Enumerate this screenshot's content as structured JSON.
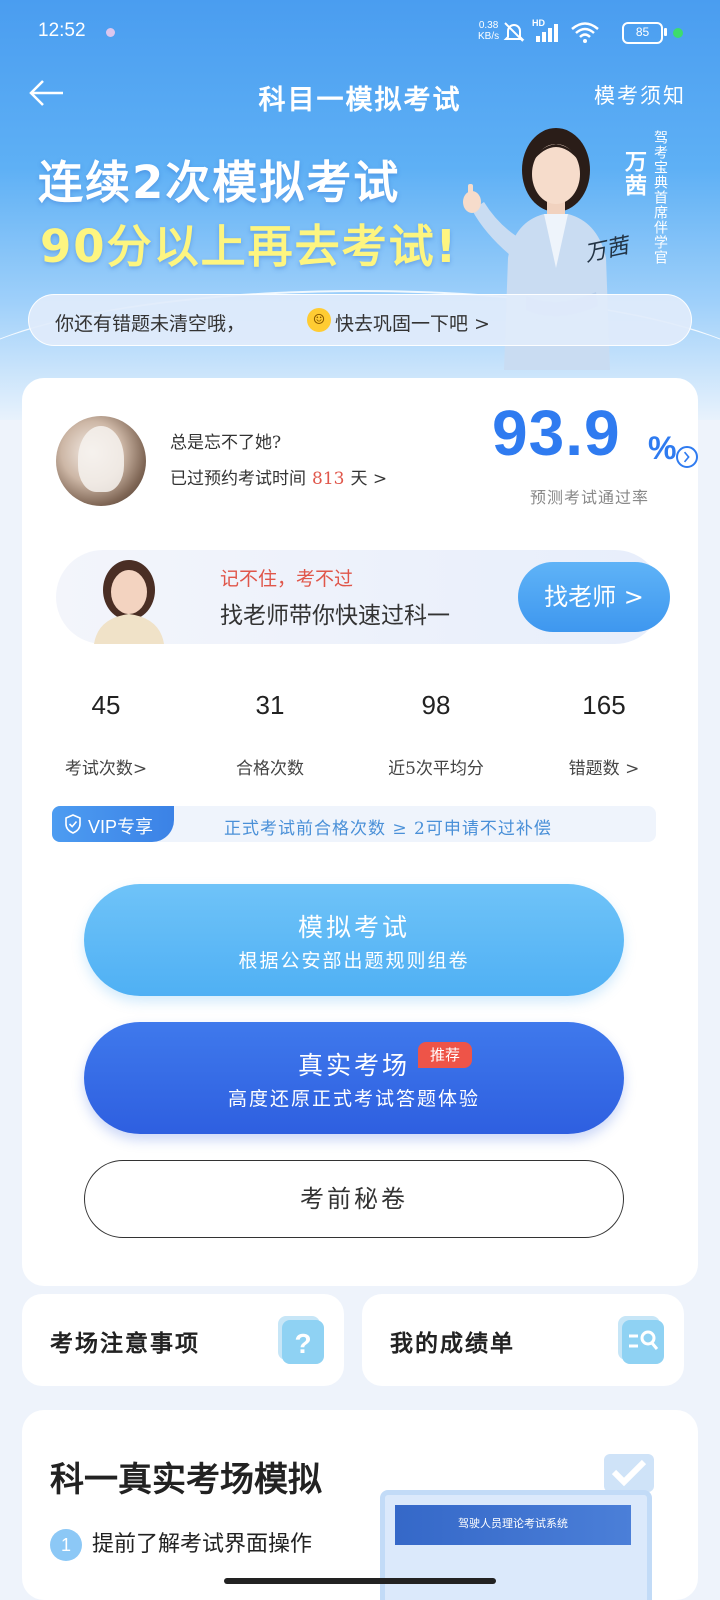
{
  "status_bar": {
    "time": "12:52",
    "net_speed_value": "0.38",
    "net_speed_unit": "KB/s",
    "network_label": "HD",
    "battery": "85"
  },
  "nav": {
    "title": "科目一模拟考试",
    "notice_link": "模考须知"
  },
  "banner": {
    "line1": "连续2次模拟考试",
    "line2": "90分以上再去考试!",
    "name": "万茜",
    "role": "驾考宝典首席伴学官",
    "signature": "万茜"
  },
  "tip": {
    "text_before": "你还有错题未清空哦，",
    "emoji": "☺",
    "text_after": "快去巩固一下吧 >"
  },
  "profile": {
    "question": "总是忘不了她?",
    "days_prefix": "已过预约考试时间",
    "days_value": "813",
    "days_suffix": "天 >",
    "pass_rate_value": "93.9",
    "pass_rate_unit": "%",
    "pass_rate_label": "预测考试通过率"
  },
  "teacher": {
    "subtitle": "记不住，考不过",
    "title": "找老师带你快速过科一",
    "button": "找老师 >"
  },
  "stats": [
    {
      "value": "45",
      "label": "考试次数>"
    },
    {
      "value": "31",
      "label": "合格次数"
    },
    {
      "value": "98",
      "label": "近5次平均分"
    },
    {
      "value": "165",
      "label": "错题数 >"
    }
  ],
  "vip": {
    "badge": "VIP专享",
    "text": "正式考试前合格次数 ≥ 2可申请不过补偿"
  },
  "buttons": {
    "mock_title": "模拟考试",
    "mock_subtitle": "根据公安部出题规则组卷",
    "real_title": "真实考场",
    "real_badge": "推荐",
    "real_subtitle": "高度还原正式考试答题体验",
    "secret": "考前秘卷"
  },
  "mini_cards": {
    "notice": "考场注意事项",
    "report": "我的成绩单"
  },
  "bottom": {
    "title": "科一真实考场模拟",
    "step_number": "1",
    "step_text": "提前了解考试界面操作",
    "screen_caption": "驾驶人员理论考试系统"
  },
  "colors": {
    "accent_blue": "#2f7bf0",
    "highlight_red": "#e0564a",
    "banner_yellow": "#fdf580"
  }
}
